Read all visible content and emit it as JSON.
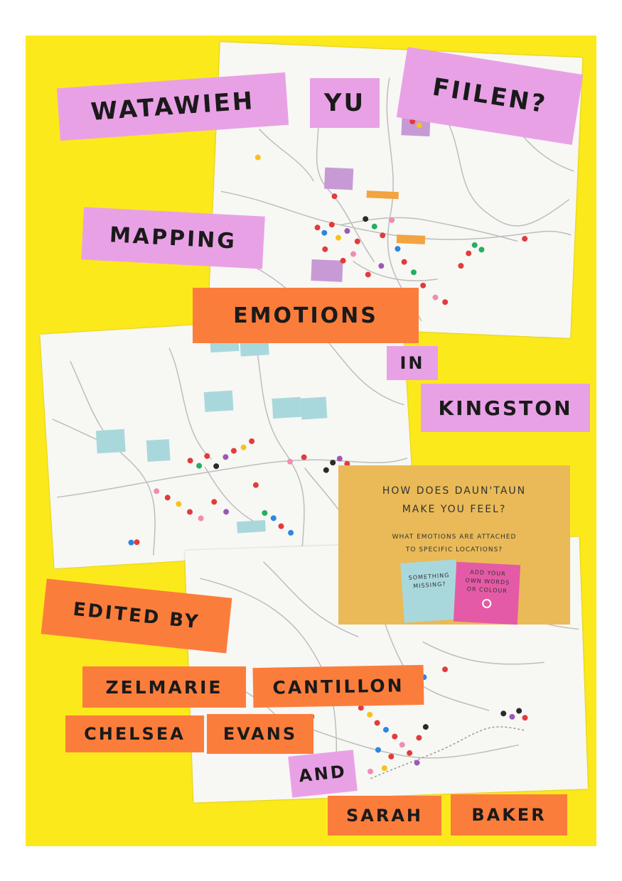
{
  "cover": {
    "title_words": [
      "WATAWIEH",
      "YU",
      "FIILEN?"
    ],
    "subtitle_words": [
      "MAPPING",
      "EMOTIONS",
      "IN",
      "KINGSTON"
    ],
    "card": {
      "question_line1": "HOW DOES DAUN'TAUN",
      "question_line2": "MAKE YOU FEEL?",
      "sub_line1": "WHAT EMOTIONS ARE ATTACHED",
      "sub_line2": "TO SPECIFIC LOCATIONS?",
      "blue_note_line1": "SOMETHING",
      "blue_note_line2": "MISSING?",
      "pink_note_line1": "ADD YOUR",
      "pink_note_line2": "OWN WORDS",
      "pink_note_line3": "OR COLOUR"
    },
    "edited_by": "EDITED BY",
    "editors": {
      "first1": "ZELMARIE",
      "last1": "CANTILLON",
      "first2": "CHELSEA",
      "last2": "EVANS",
      "conjunction": "AND",
      "first3": "SARAH",
      "last3": "BAKER"
    },
    "colors": {
      "background": "#fce91c",
      "pink_label": "#e9a1e6",
      "orange_label": "#fb7d3c",
      "card": "#e9ba57"
    }
  }
}
